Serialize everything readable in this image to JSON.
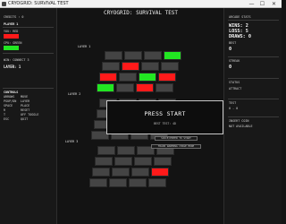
{
  "window": {
    "title": "CRYOGRID: SURVIVAL TEST",
    "minimize": "—",
    "maximize": "☐",
    "close": "✕"
  },
  "left": {
    "credits": "CREDITS : 0",
    "player": "PLAYER 1",
    "you_label": "YOU: RED",
    "you_color": "#ff1a1a",
    "cpu_label": "CPU: GREEN",
    "cpu_color": "#22e622",
    "win_condition": "WIN: CONNECT 3",
    "layer_label": "LAYER:",
    "layer_value": "1",
    "controls_title": "CONTROLS",
    "controls": [
      {
        "key": "ARROWS",
        "action": "MOVE"
      },
      {
        "key": "PGUP/DN",
        "action": "LAYER"
      },
      {
        "key": "SPACE",
        "action": "PLACE"
      },
      {
        "key": "R",
        "action": "RESET"
      },
      {
        "key": "T",
        "action": "OFF TOGGLE"
      },
      {
        "key": "ESC",
        "action": "QUIT"
      }
    ]
  },
  "main": {
    "title": "CRYOGRID: SURVIVAL TEST",
    "layers": [
      "LAYER 1",
      "LAYER 2",
      "LAYER 3"
    ],
    "overlay_title": "PRESS START",
    "overlay_sub": "BEST TEST: 4D",
    "hint_start": "SPACE/ENTER TO START",
    "hint_mode": "TRAIN WARMING   CHASE MODE",
    "layer1_cells": [
      "empty",
      "empty",
      "empty",
      "green",
      "empty",
      "red",
      "empty",
      "empty",
      "red",
      "empty",
      "green",
      "red",
      "green",
      "empty",
      "red",
      "empty"
    ],
    "layer3_cells": [
      "empty",
      "empty",
      "empty",
      "empty",
      "empty",
      "empty",
      "empty",
      "empty",
      "empty",
      "empty",
      "empty",
      "red",
      "empty",
      "empty",
      "empty",
      "empty"
    ]
  },
  "right": {
    "title": "ARCADE STATS",
    "wins": "WINS: 2",
    "loss": "LOSS: 5",
    "draws": "DRAWS: 0",
    "best_label": "BEST",
    "best_value": "0",
    "streak_label": "STREAK",
    "streak_value": "0",
    "status_label": "STATUS",
    "status_value": "ATTRACT",
    "test_label": "TEST",
    "test_value": "0 - 0",
    "credit_label": "INSERT COIN",
    "credit_value": "NOT AVAILABLE"
  },
  "colors": {
    "red": "#ff1a1a",
    "green": "#22e622",
    "empty": "#444444"
  }
}
